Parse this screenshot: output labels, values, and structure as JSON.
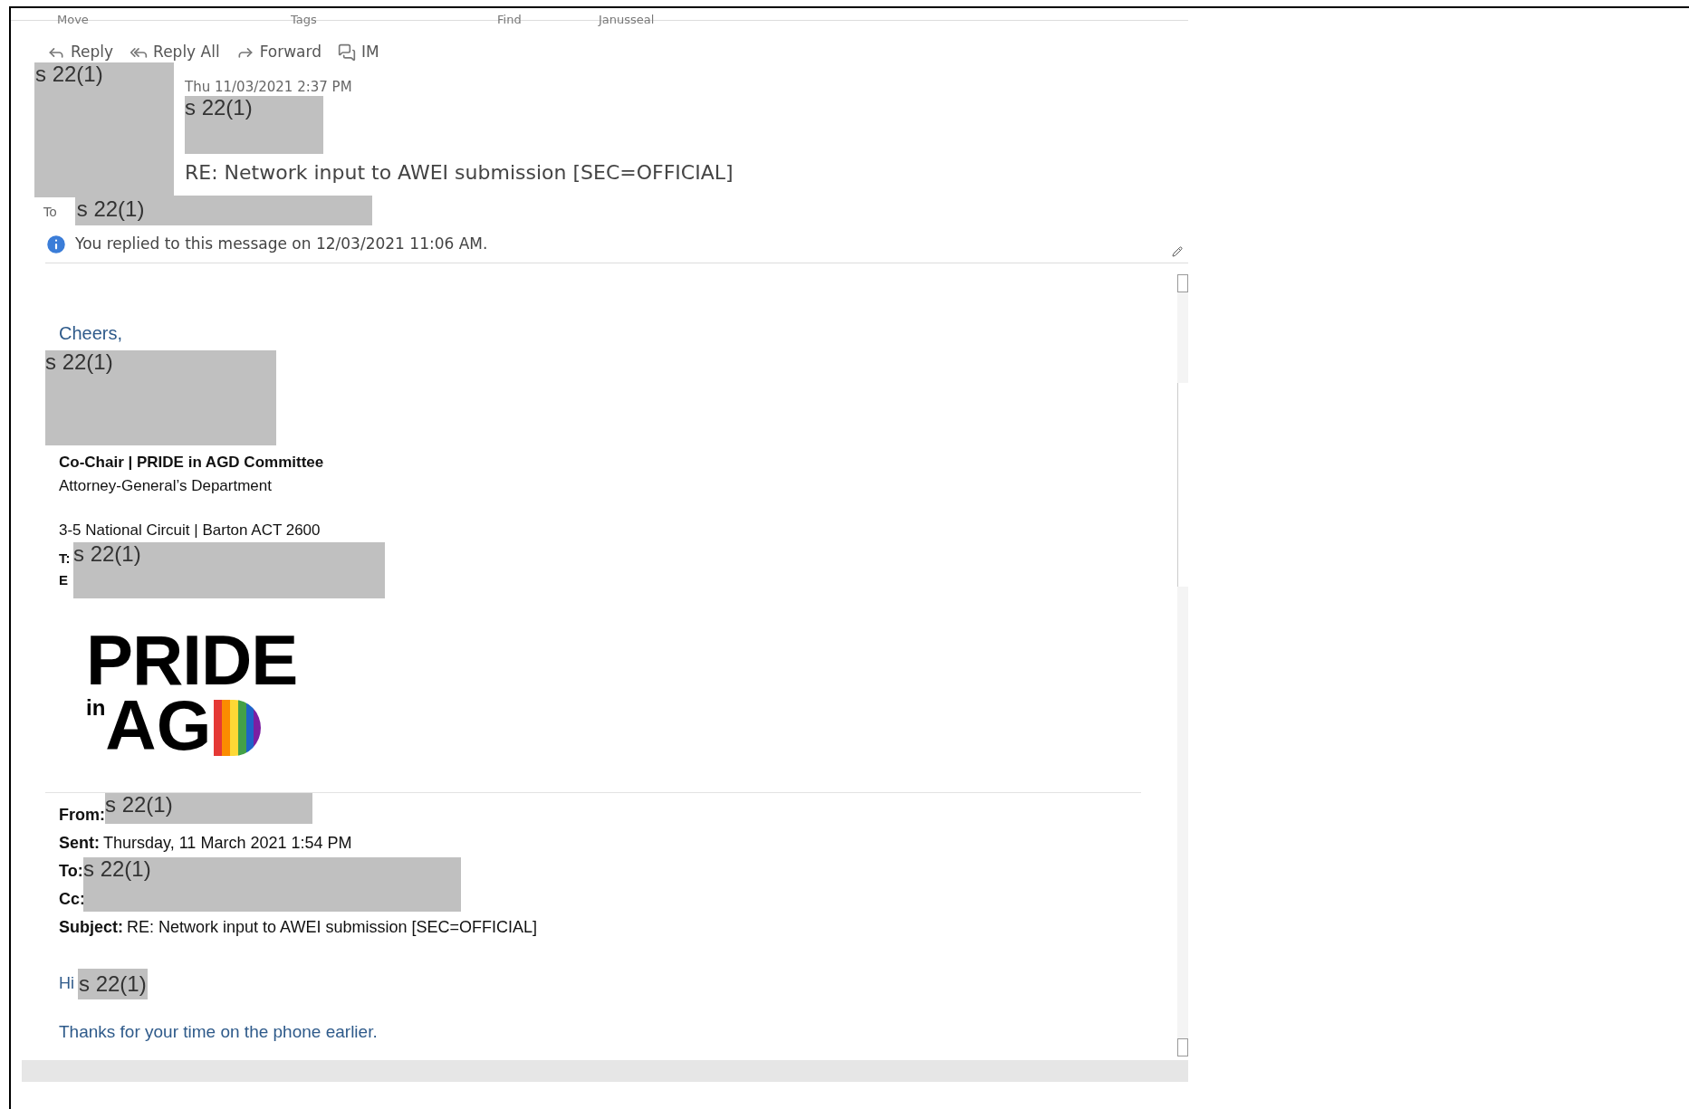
{
  "ribbon_groups": [
    "Move",
    "Tags",
    "Find",
    "Janusseal"
  ],
  "toolbar": [
    {
      "label": "Reply",
      "kind": "reply"
    },
    {
      "label": "Reply All",
      "kind": "replyall"
    },
    {
      "label": "Forward",
      "kind": "forward"
    },
    {
      "label": "IM",
      "kind": "im"
    }
  ],
  "header": {
    "sender_photo_redaction": "s 22(1)",
    "date": "Thu 11/03/2021 2:37 PM",
    "sender_redaction": "s 22(1)",
    "subject": "RE: Network input to AWEI submission [SEC=OFFICIAL]",
    "to_label": "To",
    "to_redaction": "s 22(1)",
    "info": "You replied to this message on 12/03/2021 11:06 AM."
  },
  "body": {
    "closing": "Cheers,",
    "name_redaction": "s 22(1)",
    "signature": {
      "title": "Co-Chair | PRIDE in AGD Committee",
      "department": "Attorney-General’s Department",
      "address": "3-5 National Circuit | Barton ACT 2600",
      "phone_label": "T:",
      "email_label": "E",
      "contact_redaction": "s 22(1)"
    },
    "logo": {
      "top": "PRIDE",
      "small": "in",
      "bottom": "AG"
    },
    "forwarded": {
      "from_label": "From:",
      "from_redaction": "s 22(1)",
      "sent_label": "Sent:",
      "sent": "Thursday, 11 March 2021 1:54 PM",
      "to_label": "To:",
      "cc_label": "Cc:",
      "to_cc_redaction": "s 22(1)",
      "subject_label": "Subject:",
      "subject": "RE: Network input to AWEI submission [SEC=OFFICIAL]"
    },
    "greeting": "Hi",
    "greeting_redaction": "s 22(1)",
    "message": "Thanks for your time on the phone earlier."
  }
}
